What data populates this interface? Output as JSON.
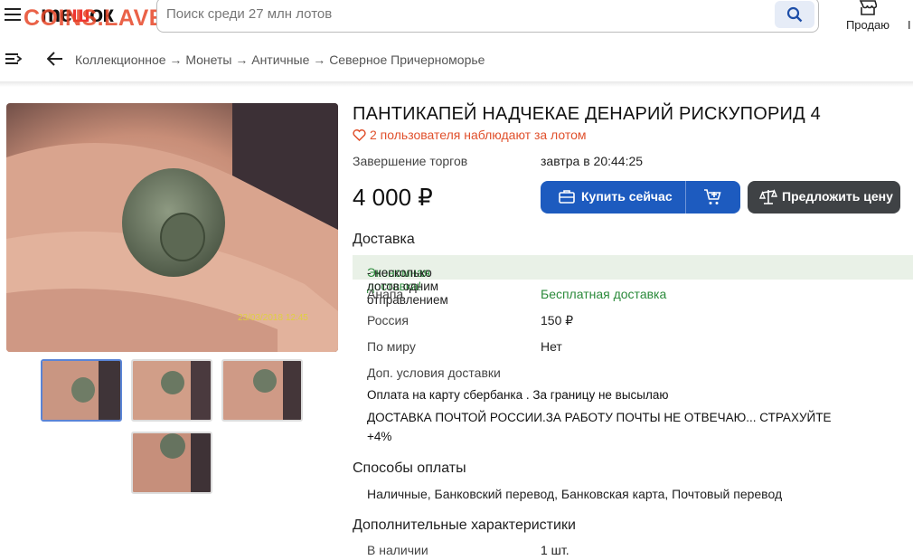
{
  "header": {
    "logo_left": "me",
    "logo_mid": "ш",
    "logo_right": "ок",
    "watermark": "COINS.LAVE.RU",
    "search_placeholder": "Поиск среди 27 млн лотов",
    "sell_label": "Продаю",
    "cut_label": "I"
  },
  "breadcrumb": {
    "path": "Коллекционное → Монеты → Античные → Северное Причерноморье"
  },
  "photo": {
    "date_stamp": "23/03/2018 12:45",
    "thumb_count": 4
  },
  "lot": {
    "title": "ПАНТИКАПЕЙ НАДЧЕКАЕ ДЕНАРИЙ РИСКУПОРИД 4",
    "watchers": "2 пользователя наблюдают за лотом",
    "end_label": "Завершение торгов",
    "end_value": "завтра в 20:44:25",
    "price": "4 000 ₽",
    "buy_now_label": "Купить сейчас",
    "offer_label": "Предложить цену"
  },
  "delivery": {
    "heading": "Доставка",
    "banner_highlight": "Экономная доставка!",
    "banner_rest": " - несколько лотов одним отправлением",
    "rows": [
      {
        "label": "Анапа",
        "value": "Бесплатная доставка"
      },
      {
        "label": "Россия",
        "value": "150 ₽"
      },
      {
        "label": "По миру",
        "value": "Нет"
      }
    ],
    "extra_label": "Доп. условия доставки",
    "extra_line1": "Оплата на карту сбербанка . За границу не высылаю",
    "extra_line2": "ДОСТАВКА ПОЧТОЙ РОССИИ.ЗА РАБОТУ ПОЧТЫ НЕ ОТВЕЧАЮ... СТРАХУЙТЕ +4%"
  },
  "payment": {
    "heading": "Способы оплаты",
    "methods": "Наличные, Банковский перевод, Банковская карта, Почтовый перевод"
  },
  "characteristics": {
    "heading": "Дополнительные характеристики",
    "rows": [
      {
        "label": "В наличии",
        "value": "1 шт."
      }
    ]
  },
  "colors": {
    "primary": "#1d5bbf",
    "dark_button": "#3f4245",
    "accent": "#e0502c",
    "green": "#2a8a3a"
  }
}
